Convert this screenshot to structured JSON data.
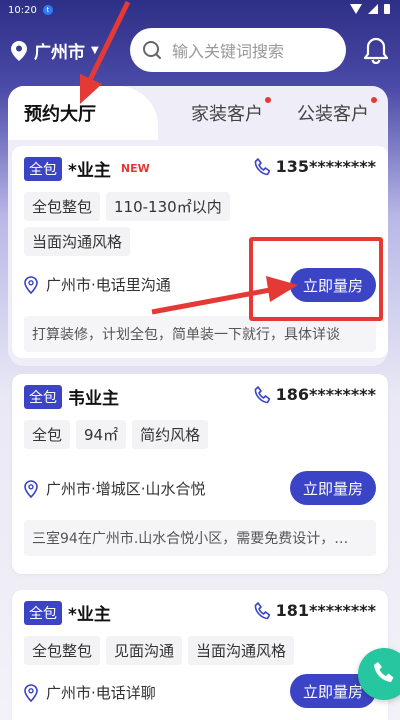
{
  "status_bar": {
    "time": "10:20",
    "notice_badge": "t"
  },
  "header": {
    "city": "广州市",
    "search_placeholder": "输入关键词搜索"
  },
  "tabs": [
    {
      "label": "预约大厅",
      "active": true
    },
    {
      "label": "家装客户",
      "dot": true
    },
    {
      "label": "公装客户",
      "dot": true
    }
  ],
  "cards": [
    {
      "badge": "全包",
      "owner": "*业主",
      "new_tag": "NEW",
      "phone": "135********",
      "tags": [
        "全包整包",
        "110-130㎡以内",
        "当面沟通风格"
      ],
      "location": "广州市·电话里沟通",
      "button": "立即量房",
      "desc": "打算装修，计划全包，简单装一下就行，具体详谈"
    },
    {
      "badge": "全包",
      "owner": "韦业主",
      "phone": "186********",
      "tags": [
        "全包",
        "94㎡",
        "简约风格"
      ],
      "location": "广州市·增城区·山水合悦",
      "button": "立即量房",
      "desc": "三室94在广州市.山水合悦小区，需要免费设计，…"
    },
    {
      "badge": "全包",
      "owner": "*业主",
      "phone": "181********",
      "tags": [
        "全包整包",
        "见面沟通",
        "当面沟通风格"
      ],
      "location": "广州市·电话详聊",
      "button": "立即量房"
    }
  ],
  "colors": {
    "accent": "#3b44c4",
    "alert": "#e53935",
    "call": "#26c6a0"
  }
}
